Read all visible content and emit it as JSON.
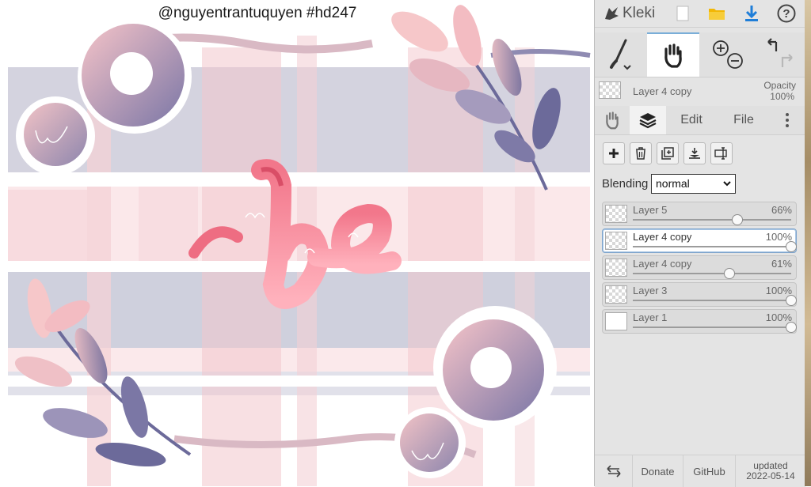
{
  "canvas": {
    "watermark": "@nguyentrantuquyen  #hd247",
    "lettering": "be"
  },
  "topbar": {
    "app_name": "Kleki",
    "icons": [
      "new-image-icon",
      "open-folder-icon",
      "download-icon",
      "help-icon"
    ],
    "help_glyph": "?"
  },
  "tools": {
    "brush": "brush-icon",
    "hand": "hand-icon",
    "zoom_in": "zoom-in-icon",
    "zoom_out": "zoom-out-icon",
    "undo": "undo-icon",
    "redo": "redo-icon",
    "active": "hand"
  },
  "layer_info": {
    "name": "Layer 4 copy",
    "opacity_label": "Opacity",
    "opacity_value": "100%"
  },
  "tabs": [
    {
      "icon": "hand-icon"
    },
    {
      "icon": "layers-icon",
      "active": true
    },
    {
      "label": "Edit"
    },
    {
      "label": "File"
    },
    {
      "icon": "more-vertical-icon"
    }
  ],
  "layer_actions": [
    "add-layer-icon",
    "delete-layer-icon",
    "duplicate-layer-icon",
    "merge-down-icon",
    "rename-layer-icon"
  ],
  "blending": {
    "label": "Blending",
    "value": "normal"
  },
  "layers": [
    {
      "name": "Layer 5",
      "opacity": "66%",
      "level": 0.66,
      "selected": false
    },
    {
      "name": "Layer 4 copy",
      "opacity": "100%",
      "level": 1.0,
      "selected": true
    },
    {
      "name": "Layer 4 copy",
      "opacity": "61%",
      "level": 0.61,
      "selected": false
    },
    {
      "name": "Layer 3",
      "opacity": "100%",
      "level": 1.0,
      "selected": false
    },
    {
      "name": "Layer 1",
      "opacity": "100%",
      "level": 1.0,
      "selected": false
    }
  ],
  "footer": {
    "swap_icon": "swap-arrows-icon",
    "donate": "Donate",
    "github": "GitHub",
    "updated_label": "updated",
    "updated_date": "2022-05-14"
  },
  "colors": {
    "pink_accent": "#f07a8c",
    "plaid_blue": "#c7c9d9",
    "plaid_pink": "#f6d2d6",
    "purple_leaf": "#6f6d9c",
    "panel_bg": "#e4e4e4",
    "selection_blue": "#7ea4cc"
  }
}
